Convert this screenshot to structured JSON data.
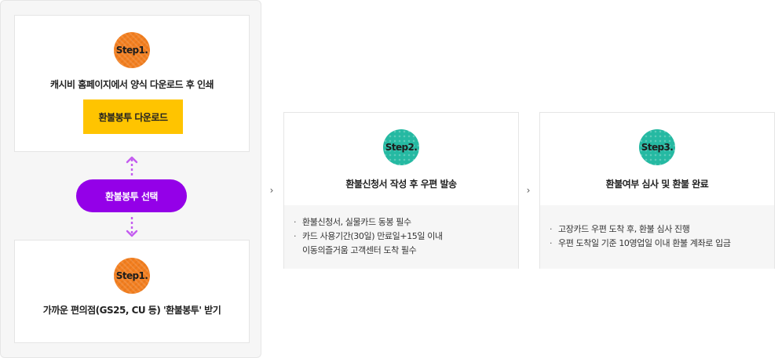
{
  "left": {
    "top_card": {
      "step_label": "Step1.",
      "text": "캐시비 홈페이지에서 양식 다운로드 후 인쇄",
      "button_label": "환불봉투 다운로드"
    },
    "select_label": "환불봉투 선택",
    "bottom_card": {
      "step_label": "Step1.",
      "text": "가까운 편의점(GS25, CU 등) '환불봉투' 받기"
    }
  },
  "chevron": "›",
  "step2": {
    "step_label": "Step2.",
    "title": "환불신청서 작성 후 우편 발송",
    "bullet": "·",
    "lines": [
      "환불신청서, 실물카드 동봉 필수",
      "카드 사용기간(30일) 만료일+15일 이내",
      "이동의즐거움 고객센터 도착 필수"
    ]
  },
  "step3": {
    "step_label": "Step3.",
    "title": "환불여부 심사 및 환불 완료",
    "bullet": "·",
    "lines": [
      "고장카드 우편 도착 후, 환불 심사 진행",
      "우편 도착일 기준 10영업일 이내 환불 계좌로 입금"
    ]
  },
  "colors": {
    "step1_badge": "#f47f1f",
    "step_badge": "#25b9a2",
    "download_button": "#ffc400",
    "select_pill": "#9400e8",
    "dashed_arrow": "#c45cf0"
  }
}
